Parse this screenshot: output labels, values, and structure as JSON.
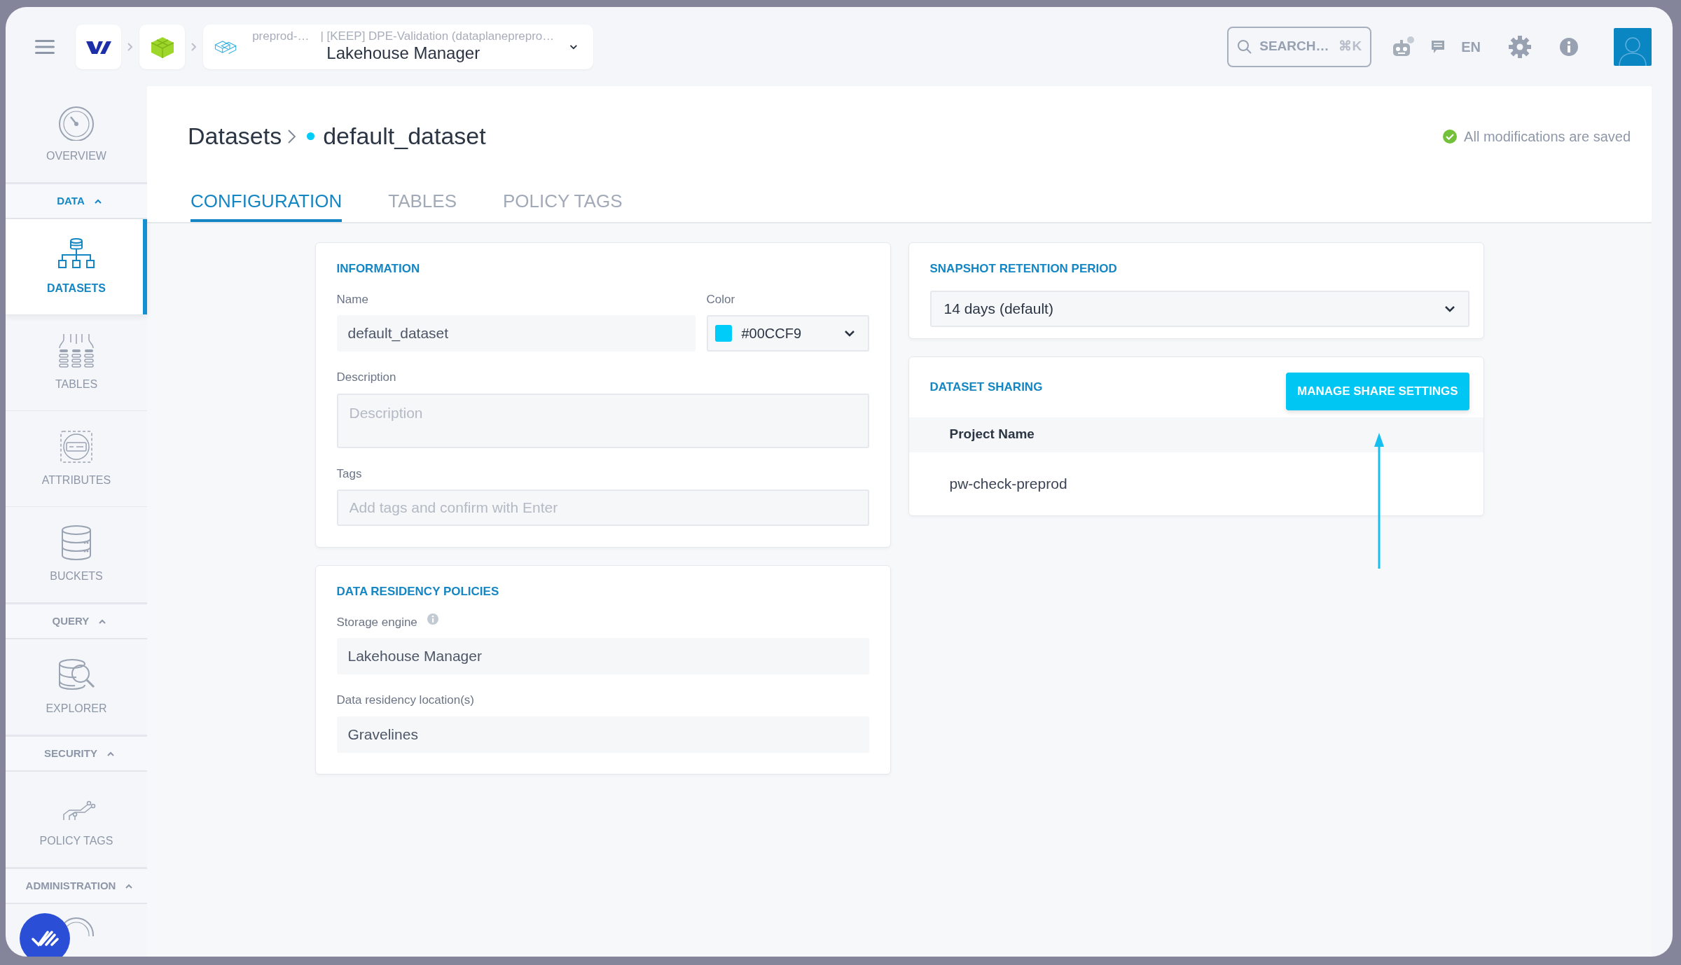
{
  "topbar": {
    "project": "preprod-…",
    "workspace": "| [KEEP] DPE-Validation (dataplaneprepro…",
    "app": "Lakehouse Manager",
    "search": {
      "placeholder": "SEARCH…",
      "shortcut": "⌘K"
    },
    "language": "EN"
  },
  "sidebar": {
    "items": [
      {
        "kind": "item",
        "label": "OVERVIEW",
        "selected": false
      },
      {
        "kind": "section",
        "label": "DATA",
        "expanded": true
      },
      {
        "kind": "item",
        "label": "DATASETS",
        "selected": true
      },
      {
        "kind": "item",
        "label": "TABLES",
        "selected": false
      },
      {
        "kind": "item",
        "label": "ATTRIBUTES",
        "selected": false
      },
      {
        "kind": "item",
        "label": "BUCKETS",
        "selected": false
      },
      {
        "kind": "section",
        "label": "QUERY",
        "expanded": true
      },
      {
        "kind": "item",
        "label": "EXPLORER",
        "selected": false
      },
      {
        "kind": "section",
        "label": "SECURITY",
        "expanded": true
      },
      {
        "kind": "item",
        "label": "POLICY TAGS",
        "selected": false
      },
      {
        "kind": "section",
        "label": "ADMINISTRATION",
        "expanded": true
      }
    ]
  },
  "page": {
    "breadcrumb": "Datasets",
    "title": "default_dataset",
    "save_status": "All modifications are saved"
  },
  "tabs": [
    {
      "label": "CONFIGURATION",
      "selected": true
    },
    {
      "label": "TABLES",
      "selected": false
    },
    {
      "label": "POLICY TAGS",
      "selected": false
    }
  ],
  "information": {
    "title": "INFORMATION",
    "name": {
      "label": "Name",
      "value": "default_dataset"
    },
    "color": {
      "label": "Color",
      "value": "#00CCF9",
      "color": "#00ccf9"
    },
    "description": {
      "label": "Description",
      "placeholder": "Description"
    },
    "tags": {
      "label": "Tags",
      "placeholder": "Add tags and confirm with Enter"
    }
  },
  "residency": {
    "title": "DATA RESIDENCY POLICIES",
    "fields": [
      {
        "label": "Storage engine",
        "info": true,
        "value": "Lakehouse Manager"
      },
      {
        "label": "Data residency location(s)",
        "info": false,
        "value": "Gravelines"
      }
    ]
  },
  "retention": {
    "title": "SNAPSHOT RETENTION PERIOD",
    "value": "14 days (default)"
  },
  "sharing": {
    "title": "DATASET SHARING",
    "button": "MANAGE SHARE SETTINGS",
    "columns": [
      "Project Name"
    ],
    "rows": [
      [
        "pw-check-preprod"
      ]
    ]
  }
}
